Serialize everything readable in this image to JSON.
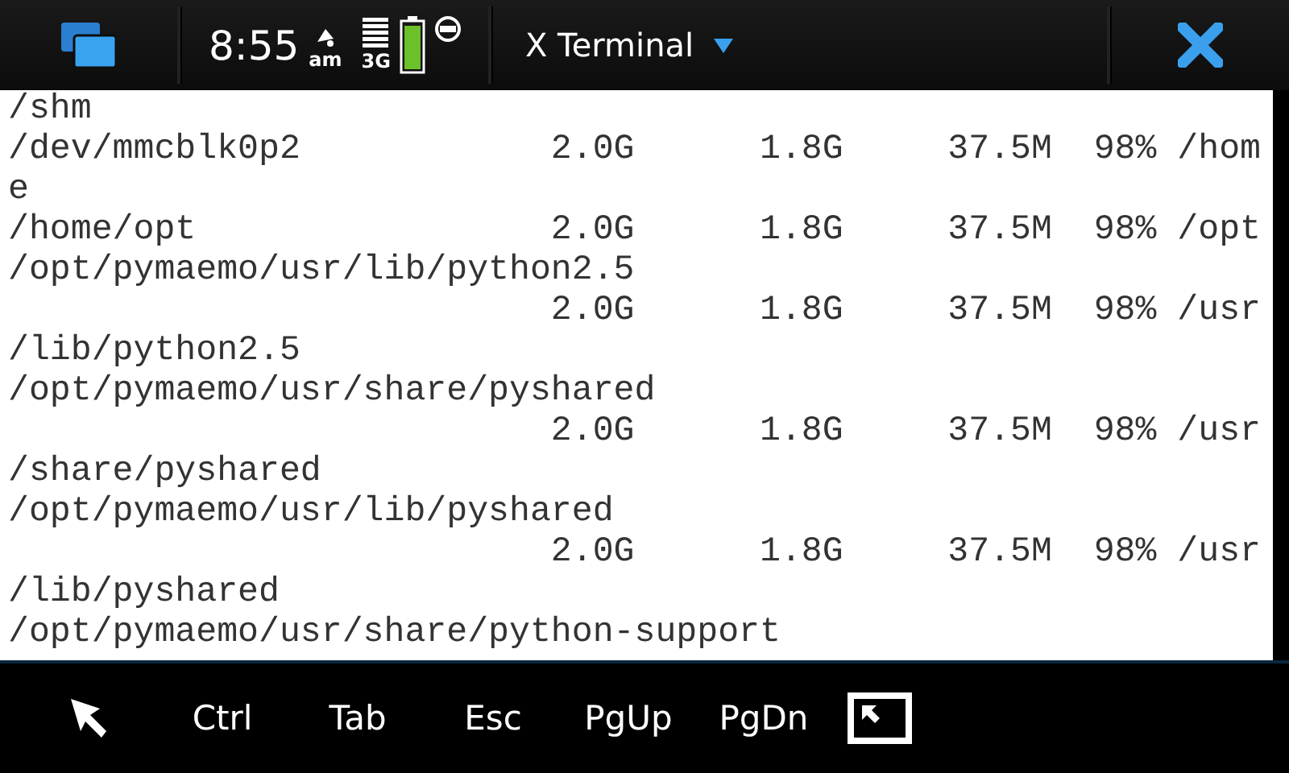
{
  "top_bar": {
    "time": "8:55",
    "ampm": "am",
    "network": "3G",
    "title": "X Terminal"
  },
  "terminal": {
    "lines": [
      "/shm",
      "/dev/mmcblk0p2            2.0G      1.8G     37.5M  98% /hom",
      "e",
      "/home/opt                 2.0G      1.8G     37.5M  98% /opt",
      "/opt/pymaemo/usr/lib/python2.5",
      "                          2.0G      1.8G     37.5M  98% /usr",
      "/lib/python2.5",
      "/opt/pymaemo/usr/share/pyshared",
      "                          2.0G      1.8G     37.5M  98% /usr",
      "/share/pyshared",
      "/opt/pymaemo/usr/lib/pyshared",
      "                          2.0G      1.8G     37.5M  98% /usr",
      "/lib/pyshared",
      "/opt/pymaemo/usr/share/python-support"
    ]
  },
  "toolbar": {
    "keys": [
      "Ctrl",
      "Tab",
      "Esc",
      "PgUp",
      "PgDn"
    ]
  }
}
